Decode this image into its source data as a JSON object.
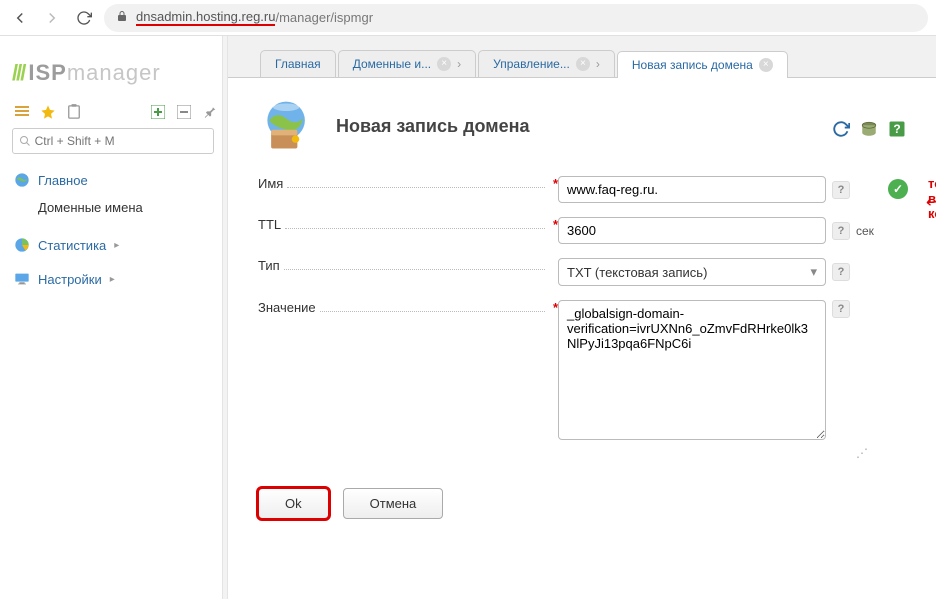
{
  "browser": {
    "url_highlighted": "dnsadmin.hosting.reg.ru",
    "url_rest": "/manager/ispmgr"
  },
  "logo": {
    "isp": "ISP",
    "mgr": "manager"
  },
  "search": {
    "placeholder": "Ctrl + Shift + M"
  },
  "sidebar": {
    "items": [
      {
        "label": "Главное"
      },
      {
        "label": "Доменные имена"
      },
      {
        "label": "Статистика"
      },
      {
        "label": "Настройки"
      }
    ]
  },
  "tabs": [
    {
      "label": "Главная"
    },
    {
      "label": "Доменные и..."
    },
    {
      "label": "Управление..."
    },
    {
      "label": "Новая запись домена"
    }
  ],
  "page": {
    "title": "Новая запись домена",
    "annotation": "точка в конце"
  },
  "form": {
    "name": {
      "label": "Имя",
      "value": "www.faq-reg.ru."
    },
    "ttl": {
      "label": "TTL",
      "value": "3600",
      "unit": "сек"
    },
    "type": {
      "label": "Тип",
      "value": "TXT (текстовая запись)"
    },
    "value": {
      "label": "Значение",
      "value": "_globalsign-domain-verification=ivrUXNn6_oZmvFdRHrke0lk3NlPyJi13pqa6FNpC6i"
    }
  },
  "buttons": {
    "ok": "Ok",
    "cancel": "Отмена"
  },
  "help": "?"
}
